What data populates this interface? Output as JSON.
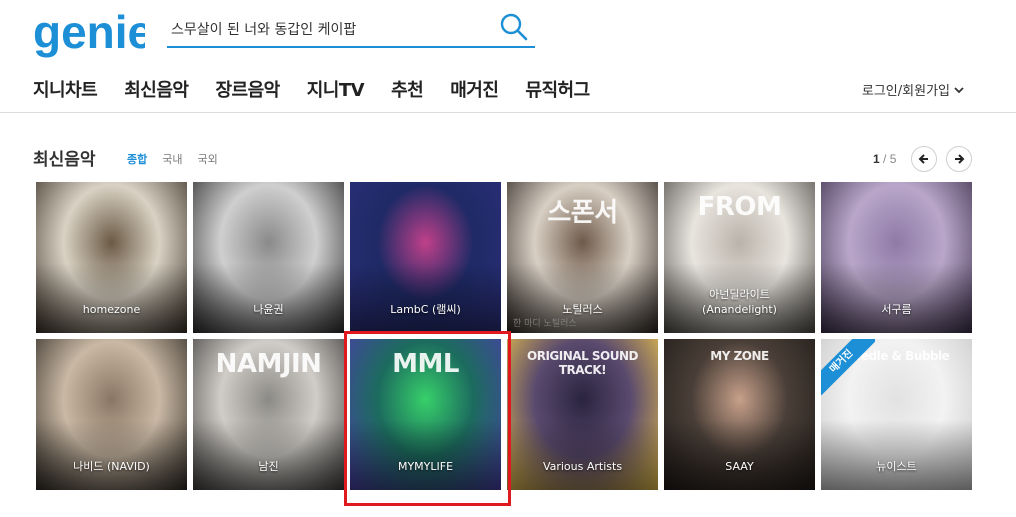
{
  "header": {
    "logo_text": "genie",
    "logo_color": "#1d8fd6",
    "search": {
      "value": "스무살이 된 너와 동갑인 케이팝",
      "icon": "search-icon"
    }
  },
  "nav": {
    "items": [
      {
        "label": "지니차트"
      },
      {
        "label": "최신음악"
      },
      {
        "label": "장르음악"
      },
      {
        "label": "지니TV"
      },
      {
        "label": "추천"
      },
      {
        "label": "매거진"
      },
      {
        "label": "뮤직허그"
      }
    ],
    "login_label": "로그인/회원가입",
    "login_icon": "chevron-down-icon"
  },
  "section": {
    "title": "최신음악",
    "tabs": [
      {
        "label": "종합",
        "active": true
      },
      {
        "label": "국내",
        "active": false
      },
      {
        "label": "국외",
        "active": false
      }
    ],
    "pager": {
      "current": "1",
      "separator": "/",
      "total": "5"
    },
    "prev_icon": "arrow-left-icon",
    "next_icon": "arrow-right-icon"
  },
  "albums": [
    {
      "name": "homezone",
      "colors": [
        "#d9d2c4",
        "#6b5a45",
        "#3a2f25"
      ]
    },
    {
      "name": "나윤권",
      "colors": [
        "#cfcfcf",
        "#8a8a8a",
        "#2a2a2a"
      ]
    },
    {
      "name": "LambC (램씨)",
      "colors": [
        "#1f2a66",
        "#c0408a",
        "#2b2f7a"
      ]
    },
    {
      "name": "노틸러스",
      "cover_text": "스폰서",
      "caption": "한 마디  노틸러스",
      "colors": [
        "#d8cfc4",
        "#6e5a4a",
        "#2c2520"
      ]
    },
    {
      "name": "아넌딜라이트\n(Anandelight)",
      "cover_text": "FROM",
      "colors": [
        "#e8e4de",
        "#b9b3aa",
        "#4d4a45"
      ]
    },
    {
      "name": "서구름",
      "colors": [
        "#b9a6c9",
        "#8e7aa6",
        "#3b2f4a"
      ]
    },
    {
      "name": "나비드 (NAVID)",
      "colors": [
        "#c9b8a4",
        "#8a7664",
        "#2f2a24"
      ]
    },
    {
      "name": "남진",
      "cover_text": "NAMJIN",
      "colors": [
        "#d0cdc8",
        "#8c8a86",
        "#3e3c3a"
      ]
    },
    {
      "name": "MYMYLIFE",
      "cover_text": "MML",
      "colors": [
        "#1c6b5e",
        "#37d06a",
        "#4a3fa8"
      ]
    },
    {
      "name": "Various Artists",
      "cover_text": "ORIGINAL SOUND TRACK!",
      "colors": [
        "#5a4a6e",
        "#2a2440",
        "#f0c84a"
      ]
    },
    {
      "name": "SAAY",
      "cover_text": "MY ZONE",
      "colors": [
        "#4a3f38",
        "#c7a08a",
        "#1f1a17"
      ]
    },
    {
      "name": "뉴이스트",
      "cover_text": "Needle & Bubble",
      "badge": "매거진",
      "colors": [
        "#f2f2f2",
        "#e2e2e2",
        "#c8c8c8"
      ]
    }
  ]
}
